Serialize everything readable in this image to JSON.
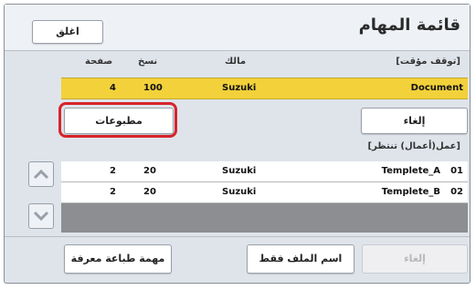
{
  "header": {
    "title": "قائمة المهام",
    "close_label": "اغلق"
  },
  "paused": {
    "section_label": "[توقف مؤقت]",
    "columns": {
      "page": "صفحة",
      "copies": "نسخ",
      "owner": "مالك"
    },
    "row": {
      "page": "4",
      "copies": "100",
      "owner": "Suzuki",
      "name": "Document"
    }
  },
  "actions": {
    "prints_label": "مطبوعات",
    "cancel_label": "إلغاء"
  },
  "waiting": {
    "section_label": "[عمل(أعمال) تنتظر]",
    "rows": [
      {
        "page": "2",
        "copies": "20",
        "owner": "Suzuki",
        "name": "Templete_A",
        "no": "01"
      },
      {
        "page": "2",
        "copies": "20",
        "owner": "Suzuki",
        "name": "Templete_B",
        "no": "02"
      }
    ]
  },
  "footer": {
    "known_job_label": "مهمة طباعة معرفة",
    "filename_only_label": "اسم الملف فقط",
    "cancel_label": "إلغاء"
  },
  "colors": {
    "highlight": "#f2d13a",
    "focus_ring": "#d7242b",
    "panel": "#dfe4eb"
  }
}
